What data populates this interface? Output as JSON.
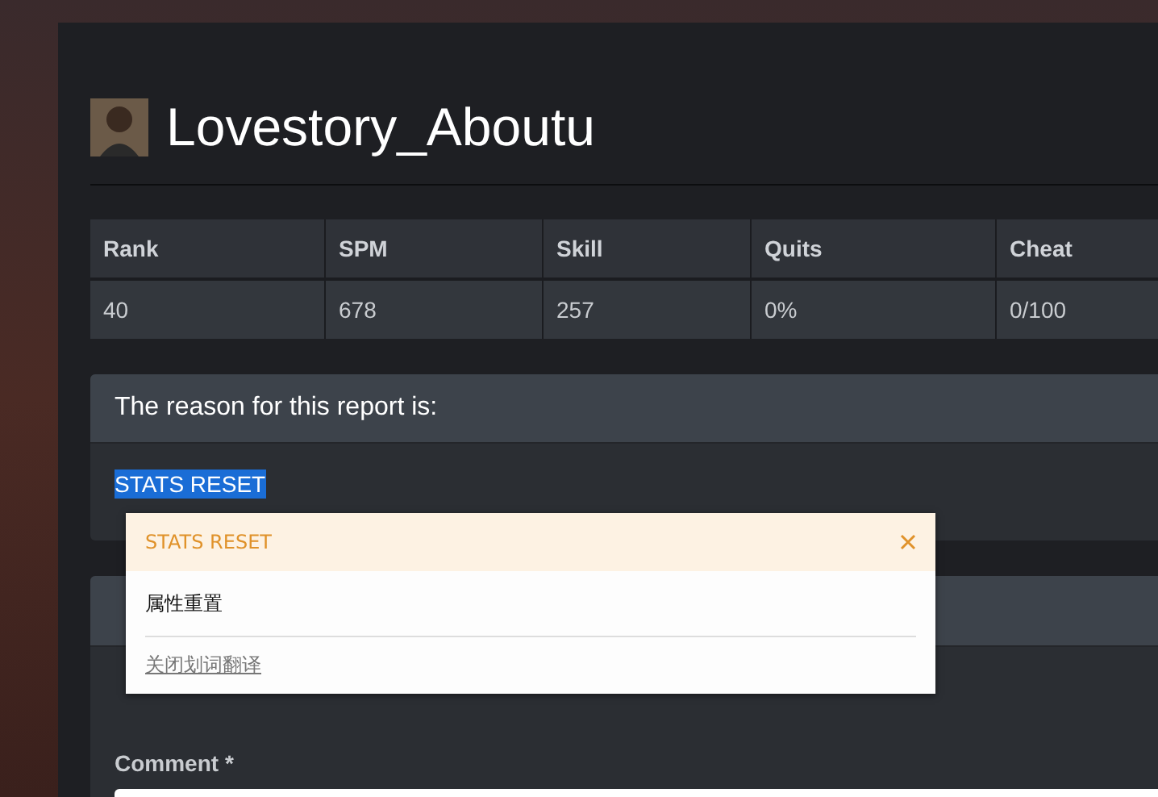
{
  "profile": {
    "name": "Lovestory_Aboutu"
  },
  "stats": {
    "columns": [
      "Rank",
      "SPM",
      "Skill",
      "Quits",
      "Cheat"
    ],
    "rows": [
      [
        "40",
        "678",
        "257",
        "0%",
        "0/100"
      ]
    ]
  },
  "reason_panel": {
    "title": "The reason for this report is:",
    "value": "STATS RESET",
    "value_selected": true
  },
  "comment": {
    "label": "Comment *"
  },
  "translation_popup": {
    "term": "STATS RESET",
    "translation": "属性重置",
    "link": "关闭划词翻译"
  }
}
